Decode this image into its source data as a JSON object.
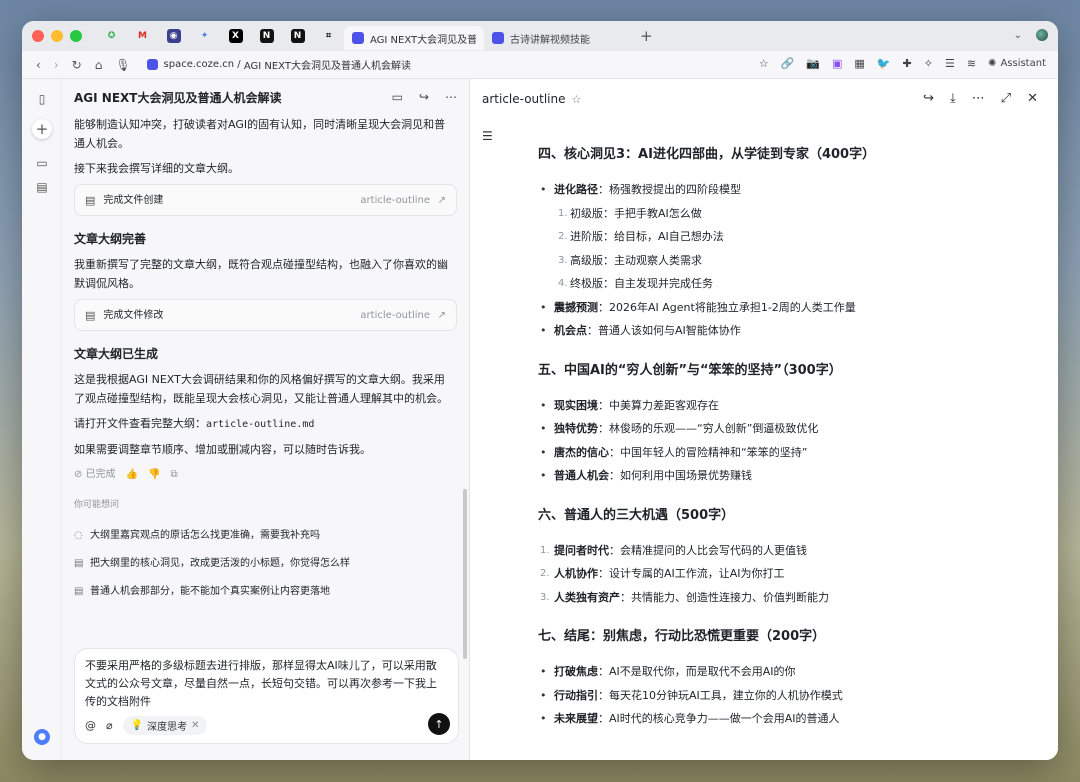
{
  "browser": {
    "pinned_tabs": [
      "coze-icon",
      "gmail-icon",
      "app-icon",
      "gemini-icon",
      "x-icon",
      "notion-icon",
      "notion-icon",
      "perplexity-icon"
    ],
    "tabs": [
      {
        "label": "AGI NEXT大会洞见及普通人机会解读",
        "active": true
      },
      {
        "label": "古诗讲解视频技能",
        "active": false
      }
    ],
    "url_host": "space.coze.cn",
    "url_title": "AGI NEXT大会洞见及普通人机会解读",
    "assistant_label": "Assistant"
  },
  "chat": {
    "title": "AGI NEXT大会洞见及普通人机会解读",
    "intro_lines": [
      "能够制造认知冲突，打破读者对AGI的固有认知，同时清晰呈现大会洞见和普",
      "通人机会。"
    ],
    "next_line": "接下来我会撰写详细的文章大纲。",
    "card1": {
      "label": "完成文件创建",
      "file": "article-outline"
    },
    "h1": "文章大纲完善",
    "p1_lines": [
      "我重新撰写了完整的文章大纲，既符合观点碰撞型结构，也融入了你喜欢的幽",
      "默调侃风格。"
    ],
    "card2": {
      "label": "完成文件修改",
      "file": "article-outline"
    },
    "h2": "文章大纲已生成",
    "p2_lines": [
      "这是我根据AGI NEXT大会调研结果和你的风格偏好撰写的文章大纲。我采用",
      "了观点碰撞型结构，既能呈现大会核心洞见，又能让普通人理解其中的机会。"
    ],
    "p3_prefix": "请打开文件查看完整大纲：",
    "p3_code": "article-outline.md",
    "p4": "如果需要调整章节顺序、增加或删减内容，可以随时告诉我。",
    "status": "已完成",
    "suggest_title": "你可能想问",
    "suggestions": [
      "大纲里嘉宾观点的原话怎么找更准确，需要我补充吗",
      "把大纲里的核心洞见，改成更活泼的小标题，你觉得怎么样",
      "普通人机会那部分，能不能加个真实案例让内容更落地"
    ],
    "composer_lines": [
      "不要采用严格的多级标题去进行排版，那样显得太AI味儿了，可以采用散",
      "文式的公众号文章，尽量自然一点，长短句交错。可以再次参考一下我上",
      "传的文档附件"
    ],
    "deep_think": "深度思考"
  },
  "doc": {
    "title": "article-outline",
    "sections": [
      {
        "title": "四、核心洞见3：AI进化四部曲，从学徒到专家（400字）",
        "items": [
          {
            "kind": "bullet",
            "label": "进化路径",
            "text": "杨强教授提出的四阶段模型",
            "sub": [
              "初级版：手把手教AI怎么做",
              "进阶版：给目标，AI自己想办法",
              "高级版：主动观察人类需求",
              "终极版：自主发现并完成任务"
            ]
          },
          {
            "kind": "bullet",
            "label": "震撼预测",
            "text": "2026年AI Agent将能独立承担1-2周的人类工作量"
          },
          {
            "kind": "bullet",
            "label": "机会点",
            "text": "普通人该如何与AI智能体协作"
          }
        ]
      },
      {
        "title": "五、中国AI的“穷人创新”与“笨笨的坚持”（300字）",
        "items": [
          {
            "kind": "bullet",
            "label": "现实困境",
            "text": "中美算力差距客观存在"
          },
          {
            "kind": "bullet",
            "label": "独特优势",
            "text": "林俊旸的乐观——“穷人创新”倒逼极致优化"
          },
          {
            "kind": "bullet",
            "label": "唐杰的信心",
            "text": "中国年轻人的冒险精神和“笨笨的坚持”"
          },
          {
            "kind": "bullet",
            "label": "普通人机会",
            "text": "如何利用中国场景优势赚钱"
          }
        ]
      },
      {
        "title": "六、普通人的三大机遇（500字）",
        "items": [
          {
            "kind": "num",
            "n": "1.",
            "label": "提问者时代",
            "text": "会精准提问的人比会写代码的人更值钱"
          },
          {
            "kind": "num",
            "n": "2.",
            "label": "人机协作",
            "text": "设计专属的AI工作流，让AI为你打工"
          },
          {
            "kind": "num",
            "n": "3.",
            "label": "人类独有资产",
            "text": "共情能力、创造性连接力、价值判断能力"
          }
        ]
      },
      {
        "title": "七、结尾：别焦虑，行动比恐慌更重要（200字）",
        "items": [
          {
            "kind": "bullet",
            "label": "打破焦虑",
            "text": "AI不是取代你，而是取代不会用AI的你"
          },
          {
            "kind": "bullet",
            "label": "行动指引",
            "text": "每天花10分钟玩AI工具，建立你的人机协作模式"
          },
          {
            "kind": "bullet",
            "label": "未来展望",
            "text": "AI时代的核心竞争力——做一个会用AI的普通人"
          }
        ]
      }
    ]
  }
}
